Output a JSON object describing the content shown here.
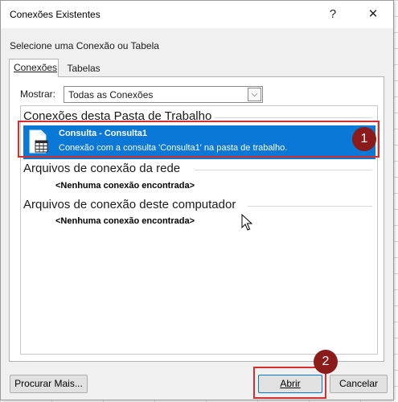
{
  "window": {
    "title": "Conexões Existentes",
    "help_glyph": "?",
    "close_glyph": "✕"
  },
  "prompt": "Selecione uma Conexão ou Tabela",
  "tabs": [
    {
      "label": "Conexões",
      "active": true
    },
    {
      "label": "Tabelas",
      "active": false
    }
  ],
  "filter": {
    "label": "Mostrar:",
    "value": "Todas as Conexões"
  },
  "groups": [
    {
      "title": "Conexões desta Pasta de Trabalho",
      "items": [
        {
          "name": "Consulta - Consulta1",
          "description": "Conexão com a consulta 'Consulta1' na pasta de trabalho.",
          "icon": "table-icon",
          "selected": true
        }
      ]
    },
    {
      "title": "Arquivos de conexão da rede",
      "empty_text": "<Nenhuma conexão encontrada>"
    },
    {
      "title": "Arquivos de conexão deste computador",
      "empty_text": "<Nenhuma conexão encontrada>"
    }
  ],
  "buttons": {
    "browse": "Procurar Mais...",
    "open": "Abrir",
    "cancel": "Cancelar"
  },
  "annotations": [
    {
      "number": "1"
    },
    {
      "number": "2"
    }
  ],
  "colors": {
    "selection": "#0a78d7",
    "callout": "#d32f2f",
    "callout_badge": "#8b1a1a"
  }
}
